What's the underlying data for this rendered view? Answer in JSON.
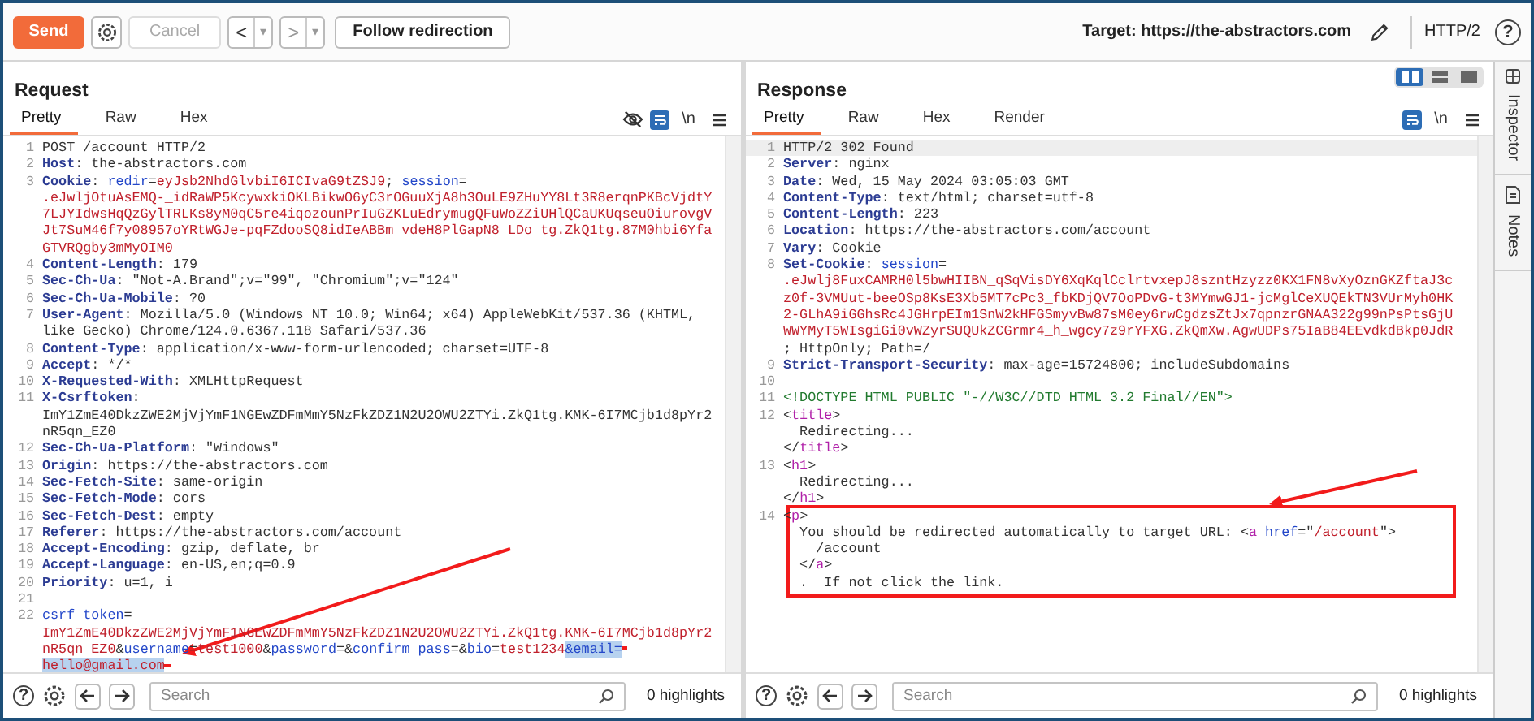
{
  "toolbar": {
    "send": "Send",
    "cancel": {
      "label": "Cancel",
      "disabled": true
    },
    "back": {
      "label": "<",
      "caret": "▾"
    },
    "forward": {
      "label": ">",
      "caret": "▾"
    },
    "follow": "Follow redirection",
    "target": "Target: https://the-abstractors.com",
    "protocol": "HTTP/2",
    "help": "?"
  },
  "request": {
    "title": "Request",
    "tabs": [
      {
        "label": "Pretty",
        "selected": true
      },
      {
        "label": "Raw",
        "selected": false
      },
      {
        "label": "Hex",
        "selected": false
      }
    ],
    "newline": "\\n",
    "lines": [
      {
        "n": "1",
        "s": [
          {
            "kind": "plain",
            "text": "POST /account HTTP/2"
          }
        ]
      },
      {
        "n": "2",
        "s": [
          {
            "kind": "key",
            "text": "Host"
          },
          {
            "kind": "plain",
            "text": ": the-abstractors.com"
          }
        ]
      },
      {
        "n": "3",
        "s": [
          {
            "kind": "key",
            "text": "Cookie"
          },
          {
            "kind": "plain",
            "text": ": "
          },
          {
            "kind": "attr",
            "text": "redir"
          },
          {
            "kind": "plain",
            "text": "="
          },
          {
            "kind": "val",
            "text": "eyJsb2NhdGlvbiI6ICIvaG9tZSJ9"
          },
          {
            "kind": "plain",
            "text": "; "
          },
          {
            "kind": "attr",
            "text": "session"
          },
          {
            "kind": "plain",
            "text": "="
          }
        ]
      },
      {
        "s": [
          {
            "kind": "val",
            "text": ".eJwljOtuAsEMQ-_idRaWP5KcywxkiOKLBikwO6yC3rOGuuXjA8h3OuLE9ZHuYY8Lt3R8erqnPKBcVjdtY"
          }
        ]
      },
      {
        "s": [
          {
            "kind": "val",
            "text": "7LJYIdwsHqQzGylTRLKs8yM0qC5re4iqozounPrIuGZKLuEdrymugQFuWoZZiUHlQCaUKUqseuOiurovgV"
          }
        ]
      },
      {
        "s": [
          {
            "kind": "val",
            "text": "Jt7SuM46f7y08957oYRtWGJe-pqFZdooSQ8idIeABBm_vdeH8PlGapN8_LDo_tg.ZkQ1tg.87M0hbi6Yfa"
          }
        ]
      },
      {
        "s": [
          {
            "kind": "val",
            "text": "GTVRQgby3mMyOIM0"
          }
        ]
      },
      {
        "n": "4",
        "s": [
          {
            "kind": "key",
            "text": "Content-Length"
          },
          {
            "kind": "plain",
            "text": ": 179"
          }
        ]
      },
      {
        "n": "5",
        "s": [
          {
            "kind": "key",
            "text": "Sec-Ch-Ua"
          },
          {
            "kind": "plain",
            "text": ": \"Not-A.Brand\";v=\"99\", \"Chromium\";v=\"124\""
          }
        ]
      },
      {
        "n": "6",
        "s": [
          {
            "kind": "key",
            "text": "Sec-Ch-Ua-Mobile"
          },
          {
            "kind": "plain",
            "text": ": ?0"
          }
        ]
      },
      {
        "n": "7",
        "s": [
          {
            "kind": "key",
            "text": "User-Agent"
          },
          {
            "kind": "plain",
            "text": ": Mozilla/5.0 (Windows NT 10.0; Win64; x64) AppleWebKit/537.36 (KHTML,"
          }
        ]
      },
      {
        "s": [
          {
            "kind": "plain",
            "text": "like Gecko) Chrome/124.0.6367.118 Safari/537.36"
          }
        ]
      },
      {
        "n": "8",
        "s": [
          {
            "kind": "key",
            "text": "Content-Type"
          },
          {
            "kind": "plain",
            "text": ": application/x-www-form-urlencoded; charset=UTF-8"
          }
        ]
      },
      {
        "n": "9",
        "s": [
          {
            "kind": "key",
            "text": "Accept"
          },
          {
            "kind": "plain",
            "text": ": */*"
          }
        ]
      },
      {
        "n": "10",
        "s": [
          {
            "kind": "key",
            "text": "X-Requested-With"
          },
          {
            "kind": "plain",
            "text": ": XMLHttpRequest"
          }
        ]
      },
      {
        "n": "11",
        "s": [
          {
            "kind": "key",
            "text": "X-Csrftoken"
          },
          {
            "kind": "plain",
            "text": ":"
          }
        ]
      },
      {
        "s": [
          {
            "kind": "plain",
            "text": "ImY1ZmE40DkzZWE2MjVjYmF1NGEwZDFmMmY5NzFkZDZ1N2U2OWU2ZTYi.ZkQ1tg.KMK-6I7MCjb1d8pYr2"
          }
        ]
      },
      {
        "s": [
          {
            "kind": "plain",
            "text": "nR5qn_EZ0"
          }
        ]
      },
      {
        "n": "12",
        "s": [
          {
            "kind": "key",
            "text": "Sec-Ch-Ua-Platform"
          },
          {
            "kind": "plain",
            "text": ": \"Windows\""
          }
        ]
      },
      {
        "n": "13",
        "s": [
          {
            "kind": "key",
            "text": "Origin"
          },
          {
            "kind": "plain",
            "text": ": https://the-abstractors.com"
          }
        ]
      },
      {
        "n": "14",
        "s": [
          {
            "kind": "key",
            "text": "Sec-Fetch-Site"
          },
          {
            "kind": "plain",
            "text": ": same-origin"
          }
        ]
      },
      {
        "n": "15",
        "s": [
          {
            "kind": "key",
            "text": "Sec-Fetch-Mode"
          },
          {
            "kind": "plain",
            "text": ": cors"
          }
        ]
      },
      {
        "n": "16",
        "s": [
          {
            "kind": "key",
            "text": "Sec-Fetch-Dest"
          },
          {
            "kind": "plain",
            "text": ": empty"
          }
        ]
      },
      {
        "n": "17",
        "s": [
          {
            "kind": "key",
            "text": "Referer"
          },
          {
            "kind": "plain",
            "text": ": https://the-abstractors.com/account"
          }
        ]
      },
      {
        "n": "18",
        "s": [
          {
            "kind": "key",
            "text": "Accept-Encoding"
          },
          {
            "kind": "plain",
            "text": ": gzip, deflate, br"
          }
        ]
      },
      {
        "n": "19",
        "s": [
          {
            "kind": "key",
            "text": "Accept-Language"
          },
          {
            "kind": "plain",
            "text": ": en-US,en;q=0.9"
          }
        ]
      },
      {
        "n": "20",
        "s": [
          {
            "kind": "key",
            "text": "Priority"
          },
          {
            "kind": "plain",
            "text": ": u=1, i"
          }
        ]
      },
      {
        "n": "21"
      },
      {
        "n": "22",
        "s": [
          {
            "kind": "attr",
            "text": "csrf_token"
          },
          {
            "kind": "plain",
            "text": "="
          }
        ]
      },
      {
        "s": [
          {
            "kind": "val",
            "text": "ImY1ZmE40DkzZWE2MjVjYmF1NGEwZDFmMmY5NzFkZDZ1N2U2OWU2ZTYi.ZkQ1tg.KMK-6I7MCjb1d8pYr2"
          }
        ]
      },
      {
        "s": [
          {
            "kind": "val",
            "text": "nR5qn_EZ0"
          },
          {
            "kind": "plain",
            "text": "&"
          },
          {
            "kind": "attr",
            "text": "username"
          },
          {
            "kind": "plain",
            "text": "="
          },
          {
            "kind": "val",
            "text": "test1000"
          },
          {
            "kind": "plain",
            "text": "&"
          },
          {
            "kind": "attr",
            "text": "password"
          },
          {
            "kind": "plain",
            "text": "=&"
          },
          {
            "kind": "attr",
            "text": "confirm_pass"
          },
          {
            "kind": "plain",
            "text": "=&"
          },
          {
            "kind": "attr",
            "text": "bio"
          },
          {
            "kind": "plain",
            "text": "="
          },
          {
            "kind": "val",
            "text": "test1234"
          },
          {
            "kind": "attr-selected",
            "text": "&email="
          }
        ]
      },
      {
        "s": [
          {
            "kind": "val-selected",
            "text": "hello@gmail.com"
          }
        ]
      }
    ],
    "search": {
      "placeholder": "Search"
    },
    "highlights": "0 highlights",
    "help": "?"
  },
  "response": {
    "title": "Response",
    "tabs": [
      {
        "label": "Pretty",
        "selected": true
      },
      {
        "label": "Raw",
        "selected": false
      },
      {
        "label": "Hex",
        "selected": false
      },
      {
        "label": "Render",
        "selected": false
      }
    ],
    "newline": "\\n",
    "lines": [
      {
        "n": "1",
        "s": [
          {
            "kind": "plain",
            "text": "HTTP/2 302 Found"
          }
        ]
      },
      {
        "n": "2",
        "s": [
          {
            "kind": "key",
            "text": "Server"
          },
          {
            "kind": "plain",
            "text": ": nginx"
          }
        ]
      },
      {
        "n": "3",
        "s": [
          {
            "kind": "key",
            "text": "Date"
          },
          {
            "kind": "plain",
            "text": ": Wed, 15 May 2024 03:05:03 GMT"
          }
        ]
      },
      {
        "n": "4",
        "s": [
          {
            "kind": "key",
            "text": "Content-Type"
          },
          {
            "kind": "plain",
            "text": ": text/html; charset=utf-8"
          }
        ]
      },
      {
        "n": "5",
        "s": [
          {
            "kind": "key",
            "text": "Content-Length"
          },
          {
            "kind": "plain",
            "text": ": 223"
          }
        ]
      },
      {
        "n": "6",
        "s": [
          {
            "kind": "key",
            "text": "Location"
          },
          {
            "kind": "plain",
            "text": ": https://the-abstractors.com/account"
          }
        ]
      },
      {
        "n": "7",
        "s": [
          {
            "kind": "key",
            "text": "Vary"
          },
          {
            "kind": "plain",
            "text": ": Cookie"
          }
        ]
      },
      {
        "n": "8",
        "s": [
          {
            "kind": "key",
            "text": "Set-Cookie"
          },
          {
            "kind": "plain",
            "text": ": "
          },
          {
            "kind": "attr",
            "text": "session"
          },
          {
            "kind": "plain",
            "text": "="
          }
        ]
      },
      {
        "s": [
          {
            "kind": "val",
            "text": ".eJwlj8FuxCAMRH0l5bwHIIBN_qSqVisDY6XqKqlCclrtvxepJ8szntHzyzz0KX1FN8vXyOznGKZftaJ3c"
          }
        ]
      },
      {
        "s": [
          {
            "kind": "val",
            "text": "z0f-3VMUut-beeOSp8KsE3Xb5MT7cPc3_fbKDjQV7OoPDvG-t3MYmwGJ1-jcMglCeXUQEkTN3VUrMyh0HK"
          }
        ]
      },
      {
        "s": [
          {
            "kind": "val",
            "text": "2-GLhA9iGGhsRc4JGHrpEIm1SnW2kHFGSmyvBw87sM0ey6rwCgdzsZtJx7qpnzrGNAA322g99nPsPtsGjU"
          }
        ]
      },
      {
        "s": [
          {
            "kind": "val",
            "text": "WWYMyT5WIsgiGi0vWZyrSUQUkZCGrmr4_h_wgcy7z9rYFXG.ZkQmXw.AgwUDPs75IaB84EEvdkdBkp0JdR"
          }
        ]
      },
      {
        "s": [
          {
            "kind": "plain",
            "text": "; HttpOnly; Path=/"
          }
        ]
      },
      {
        "n": "9",
        "s": [
          {
            "kind": "key",
            "text": "Strict-Transport-Security"
          },
          {
            "kind": "plain",
            "text": ": max-age=15724800; includeSubdomains"
          }
        ]
      },
      {
        "n": "10"
      },
      {
        "n": "11",
        "s": [
          {
            "kind": "doc",
            "text": "<!DOCTYPE HTML PUBLIC \"-//W3C//DTD HTML 3.2 Final//EN\">"
          }
        ]
      },
      {
        "n": "12",
        "s": [
          {
            "kind": "plain",
            "text": "<"
          },
          {
            "kind": "tag",
            "text": "title"
          },
          {
            "kind": "plain",
            "text": ">"
          }
        ]
      },
      {
        "s": [
          {
            "kind": "plain",
            "text": "  Redirecting..."
          }
        ]
      },
      {
        "s": [
          {
            "kind": "plain",
            "text": "</"
          },
          {
            "kind": "tag",
            "text": "title"
          },
          {
            "kind": "plain",
            "text": ">"
          }
        ]
      },
      {
        "n": "13",
        "s": [
          {
            "kind": "plain",
            "text": "<"
          },
          {
            "kind": "tag",
            "text": "h1"
          },
          {
            "kind": "plain",
            "text": ">"
          }
        ]
      },
      {
        "s": [
          {
            "kind": "plain",
            "text": "  Redirecting..."
          }
        ]
      },
      {
        "s": [
          {
            "kind": "plain",
            "text": "</"
          },
          {
            "kind": "tag",
            "text": "h1"
          },
          {
            "kind": "plain",
            "text": ">"
          }
        ]
      },
      {
        "n": "14",
        "s": [
          {
            "kind": "plain",
            "text": "<"
          },
          {
            "kind": "tag",
            "text": "p"
          },
          {
            "kind": "plain",
            "text": ">"
          }
        ]
      },
      {
        "s": [
          {
            "kind": "plain",
            "text": "  You should be redirected automatically to target URL: <"
          },
          {
            "kind": "tag",
            "text": "a "
          },
          {
            "kind": "attr",
            "text": "href"
          },
          {
            "kind": "plain",
            "text": "=\""
          },
          {
            "kind": "val",
            "text": "/account"
          },
          {
            "kind": "plain",
            "text": "\">"
          }
        ]
      },
      {
        "s": [
          {
            "kind": "plain",
            "text": "    /account"
          }
        ]
      },
      {
        "s": [
          {
            "kind": "plain",
            "text": "  </"
          },
          {
            "kind": "tag",
            "text": "a"
          },
          {
            "kind": "plain",
            "text": ">"
          }
        ]
      },
      {
        "s": [
          {
            "kind": "plain",
            "text": "  .  If not click the link."
          }
        ]
      }
    ],
    "search": {
      "placeholder": "Search"
    },
    "highlights": "0 highlights",
    "help": "?"
  },
  "side_tabs": [
    "Inspector",
    "Notes"
  ]
}
